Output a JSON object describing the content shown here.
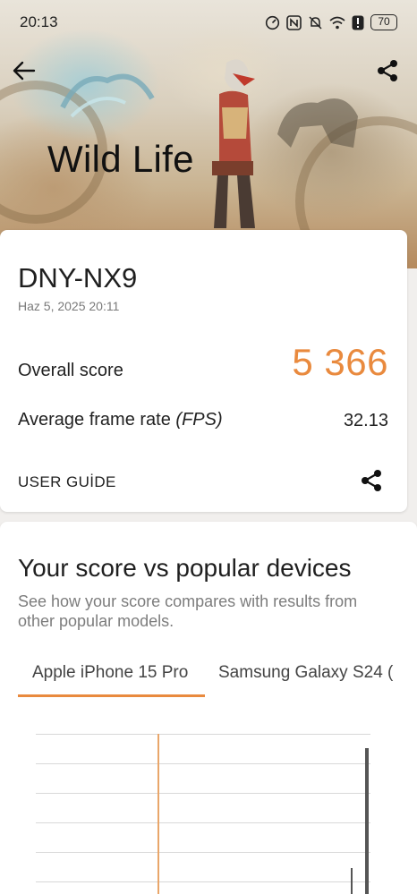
{
  "status_bar": {
    "time": "20:13",
    "battery": "70",
    "icons": [
      "speed-icon",
      "nfc-icon",
      "mute-icon",
      "wifi-icon",
      "alert-icon",
      "battery-icon"
    ]
  },
  "header": {
    "title": "Wild Life",
    "back_icon": "arrow-left-icon",
    "share_icon": "share-icon"
  },
  "result": {
    "device": "DNY-NX9",
    "timestamp": "Haz 5, 2025 20:11",
    "overall_label": "Overall score",
    "overall_value": "5 366",
    "fps_label": "Average frame rate",
    "fps_unit": "(FPS)",
    "fps_value": "32.13",
    "guide_label": "USER GUİDE"
  },
  "comparison": {
    "title": "Your score vs popular devices",
    "description": "See how your score compares with results from other popular models.",
    "tabs": [
      {
        "label": "Apple iPhone 15 Pro",
        "active": true
      },
      {
        "label": "Samsung Galaxy S24 (",
        "active": false
      }
    ]
  },
  "colors": {
    "accent": "#e98a3e",
    "text": "#1f1f1f",
    "muted": "#7d7d7d"
  }
}
